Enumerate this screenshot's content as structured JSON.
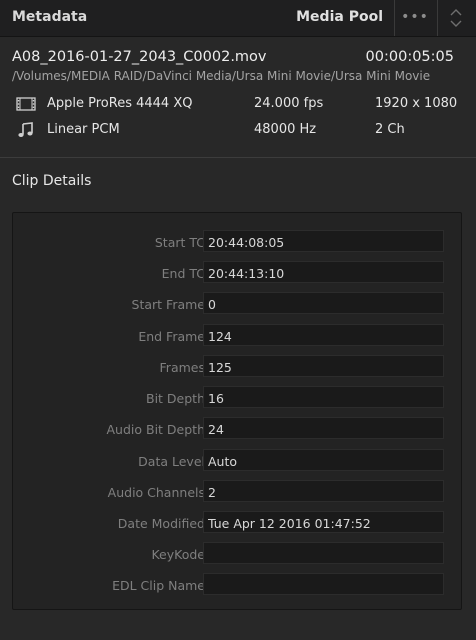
{
  "header": {
    "title": "Metadata",
    "media_pool_label": "Media Pool",
    "more_label": "•••"
  },
  "file": {
    "name": "A08_2016-01-27_2043_C0002.mov",
    "duration": "00:00:05:05",
    "path": "/Volumes/MEDIA RAID/DaVinci Media/Ursa Mini Movie/Ursa Mini Movie"
  },
  "video": {
    "icon": "film-strip-icon",
    "codec": "Apple ProRes 4444 XQ",
    "fps": "24.000 fps",
    "resolution": "1920 x 1080"
  },
  "audio": {
    "icon": "music-note-icon",
    "codec": "Linear PCM",
    "rate": "48000 Hz",
    "channels": "2 Ch"
  },
  "clip_details": {
    "title": "Clip Details",
    "rows": [
      {
        "label": "Start TC",
        "value": "20:44:08:05"
      },
      {
        "label": "End TC",
        "value": "20:44:13:10"
      },
      {
        "label": "Start Frame",
        "value": "0"
      },
      {
        "label": "End Frame",
        "value": "124"
      },
      {
        "label": "Frames",
        "value": "125"
      },
      {
        "label": "Bit Depth",
        "value": "16"
      },
      {
        "label": "Audio Bit Depth",
        "value": "24"
      },
      {
        "label": "Data Level",
        "value": "Auto"
      },
      {
        "label": "Audio Channels",
        "value": "2"
      },
      {
        "label": "Date Modified",
        "value": "Tue Apr 12 2016 01:47:52"
      },
      {
        "label": "KeyKode",
        "value": ""
      },
      {
        "label": "EDL Clip Name",
        "value": ""
      }
    ]
  },
  "colors": {
    "background": "#282828",
    "header_bg": "#1f1f20",
    "field_bg": "#1a1a1a",
    "label_text": "#7f7f7f",
    "value_text": "#d8d8d8"
  }
}
